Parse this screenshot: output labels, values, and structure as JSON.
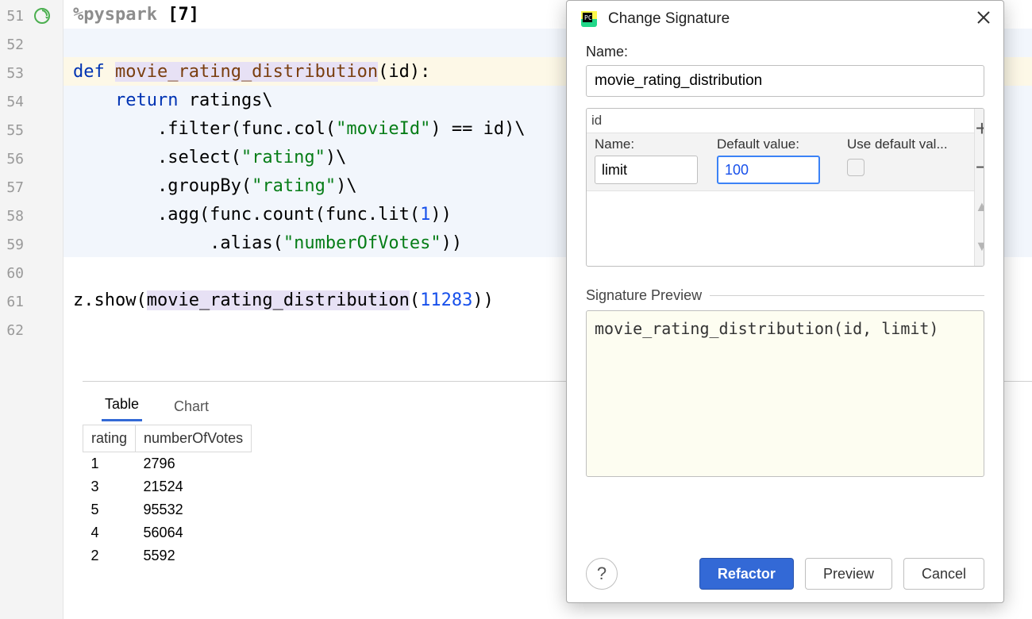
{
  "gutter": {
    "lines": [
      "51",
      "52",
      "53",
      "54",
      "55",
      "56",
      "57",
      "58",
      "59",
      "60",
      "61",
      "62"
    ]
  },
  "code": {
    "line51_prefix": "%pyspark",
    "line51_cell": " [7]",
    "def_kw": "def",
    "fn_name": "movie_rating_distribution",
    "fn_sig_rest": "(id):",
    "ret_kw": "return",
    "ret_rest": " ratings\\",
    "l55": "        .filter(func.col(",
    "l55_str": "\"movieId\"",
    "l55_rest": ") == id)\\",
    "l56a": "        .select(",
    "l56_str": "\"rating\"",
    "l56b": ")\\",
    "l57a": "        .groupBy(",
    "l57_str": "\"rating\"",
    "l57b": ")\\",
    "l58a": "        .agg(func.count(func.lit(",
    "l58_num": "1",
    "l58b": "))",
    "l59a": "             .alias(",
    "l59_str": "\"numberOfVotes\"",
    "l59b": "))",
    "l61a": "z.show(",
    "l61_fn": "movie_rating_distribution",
    "l61b": "(",
    "l61_num": "11283",
    "l61c": "))"
  },
  "result": {
    "tabs": {
      "table": "Table",
      "chart": "Chart"
    },
    "headers": {
      "c1": "rating",
      "c2": "numberOfVotes"
    },
    "rows": [
      {
        "c1": "1",
        "c2": "2796"
      },
      {
        "c1": "3",
        "c2": "21524"
      },
      {
        "c1": "5",
        "c2": "95532"
      },
      {
        "c1": "4",
        "c2": "56064"
      },
      {
        "c1": "2",
        "c2": "5592"
      }
    ]
  },
  "dialog": {
    "title": "Change Signature",
    "name_label": "Name:",
    "name_value": "movie_rating_distribution",
    "param_chip": "id",
    "col_name": "Name:",
    "col_default": "Default value:",
    "col_usedef": "Use default val...",
    "param_name_value": "limit",
    "param_default_value": "100",
    "preview_label": "Signature Preview",
    "preview_text": "movie_rating_distribution(id, limit)",
    "buttons": {
      "refactor": "Refactor",
      "preview": "Preview",
      "cancel": "Cancel"
    },
    "side": {
      "add": "+",
      "remove": "−",
      "up": "▲",
      "down": "▼"
    },
    "help": "?"
  }
}
